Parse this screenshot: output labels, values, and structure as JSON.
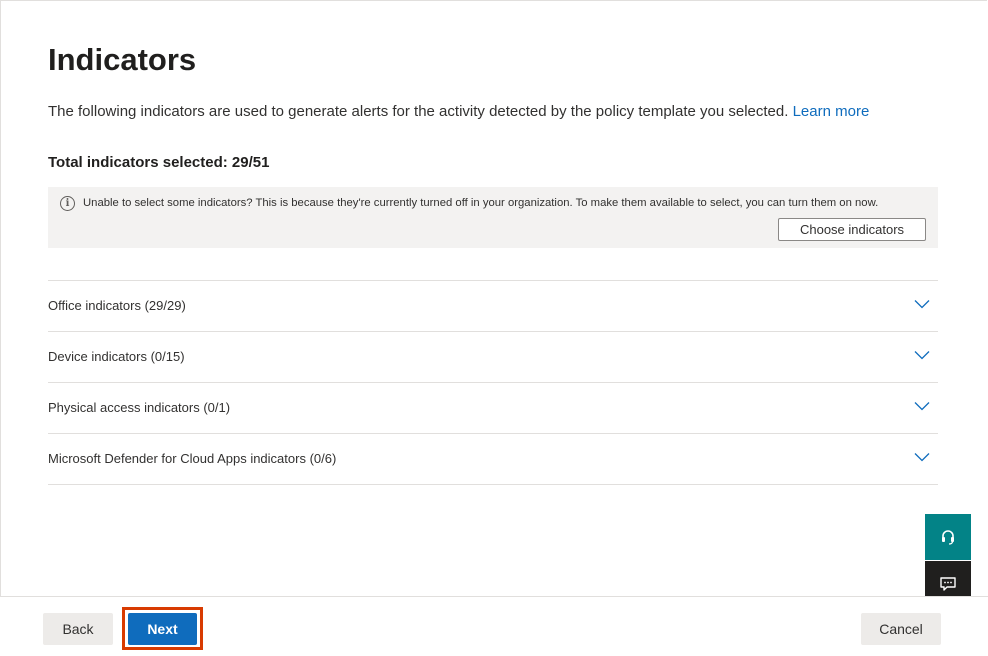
{
  "page": {
    "title": "Indicators",
    "description": "The following indicators are used to generate alerts for the activity detected by the policy template you selected.",
    "learn_more": "Learn more",
    "total_selected": "Total indicators selected: 29/51"
  },
  "info": {
    "icon": "info-icon",
    "text": "Unable to select some indicators? This is because they're currently turned off in your organization. To make them available to select, you can turn them on now.",
    "button": "Choose indicators"
  },
  "accordion": [
    {
      "label": "Office indicators (29/29)",
      "icon": "chevron-down-icon"
    },
    {
      "label": "Device indicators (0/15)",
      "icon": "chevron-down-icon"
    },
    {
      "label": "Physical access indicators (0/1)",
      "icon": "chevron-down-icon"
    },
    {
      "label": "Microsoft Defender for Cloud Apps indicators (0/6)",
      "icon": "chevron-down-icon"
    }
  ],
  "floating": {
    "support_icon": "headset-icon",
    "feedback_icon": "feedback-icon"
  },
  "footer": {
    "back": "Back",
    "next": "Next",
    "cancel": "Cancel"
  },
  "colors": {
    "accent": "#0f6cbd",
    "highlight": "#d83b01",
    "support": "#038387"
  }
}
